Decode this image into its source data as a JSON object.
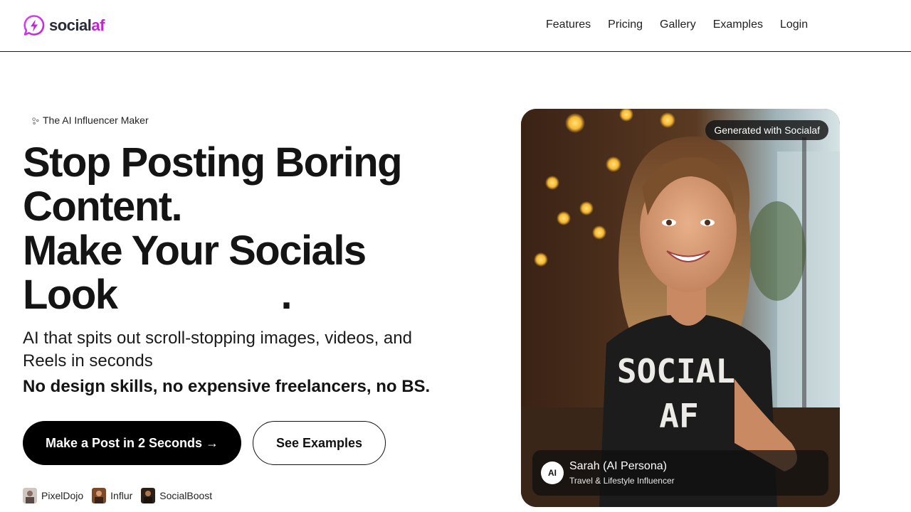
{
  "brand": {
    "name_prefix": "social",
    "name_suffix": "af",
    "accent_color": "#c026d3"
  },
  "nav": {
    "items": [
      "Features",
      "Pricing",
      "Gallery",
      "Examples",
      "Login"
    ]
  },
  "hero": {
    "badge": "The AI Influencer Maker",
    "headline": {
      "line1": "Stop Posting Boring",
      "line2": "Content.",
      "line3": "Make Your Socials",
      "line4_start": "Look",
      "line4_end": "."
    },
    "subheadline": "AI that spits out scroll-stopping images, videos, and Reels in seconds",
    "tagline": "No design skills, no expensive freelancers, no BS.",
    "primary_cta": "Make a Post in 2 Seconds →",
    "secondary_cta": "See Examples",
    "partners": [
      "PixelDojo",
      "Influr",
      "SocialBoost"
    ]
  },
  "showcase": {
    "badge": "Generated with Socialaf",
    "shirt_text_line1": "SOCIAL",
    "shirt_text_line2": "AF",
    "persona": {
      "avatar_initials": "AI",
      "name": "Sarah (AI Persona)",
      "role": "Travel & Lifestyle Influencer"
    }
  }
}
